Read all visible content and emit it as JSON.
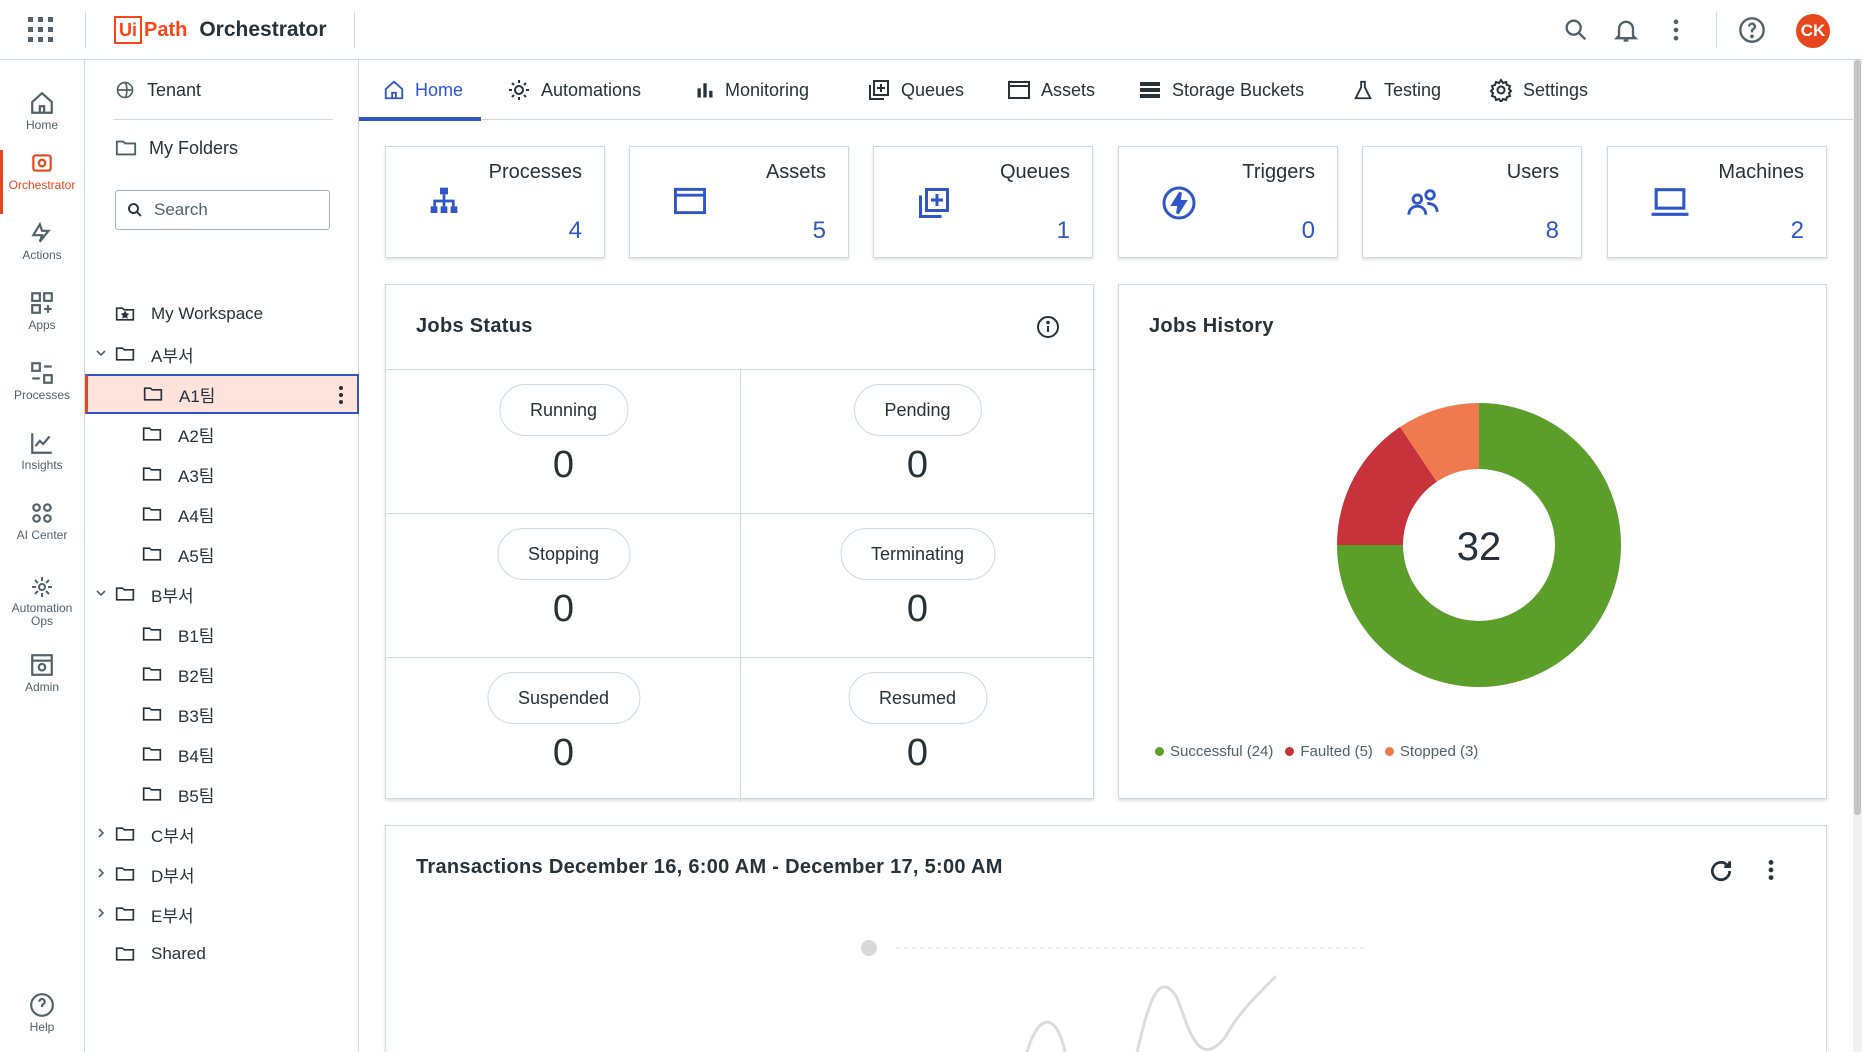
{
  "header": {
    "brand_ui": "Ui",
    "brand_path": "Path",
    "product": "Orchestrator",
    "avatar_initials": "CK"
  },
  "rail": {
    "items": [
      {
        "label": "Home",
        "icon": "home-icon"
      },
      {
        "label": "Orchestrator",
        "icon": "orchestrator-icon",
        "active": true
      },
      {
        "label": "Actions",
        "icon": "actions-icon"
      },
      {
        "label": "Apps",
        "icon": "apps-icon"
      },
      {
        "label": "Processes",
        "icon": "processes-icon"
      },
      {
        "label": "Insights",
        "icon": "insights-icon"
      },
      {
        "label": "AI Center",
        "icon": "ai-center-icon"
      },
      {
        "label": "Automation",
        "label2": "Ops",
        "icon": "automation-ops-icon"
      },
      {
        "label": "Admin",
        "icon": "admin-icon"
      },
      {
        "label": "Help",
        "icon": "help-icon"
      }
    ]
  },
  "tree": {
    "tenant": "Tenant",
    "my_folders": "My Folders",
    "search_placeholder": "Search",
    "nodes": [
      "My Workspace",
      "A부서",
      "A1팀",
      "A2팀",
      "A3팀",
      "A4팀",
      "A5팀",
      "B부서",
      "B1팀",
      "B2팀",
      "B3팀",
      "B4팀",
      "B5팀",
      "C부서",
      "D부서",
      "E부서",
      "Shared"
    ],
    "selected": "A1팀"
  },
  "tabs": [
    "Home",
    "Automations",
    "Monitoring",
    "Queues",
    "Assets",
    "Storage Buckets",
    "Testing",
    "Settings"
  ],
  "stats": [
    {
      "title": "Processes",
      "value": "4",
      "icon": "processes-tree-icon"
    },
    {
      "title": "Assets",
      "value": "5",
      "icon": "assets-window-icon"
    },
    {
      "title": "Queues",
      "value": "1",
      "icon": "queues-add-icon"
    },
    {
      "title": "Triggers",
      "value": "0",
      "icon": "triggers-bolt-icon"
    },
    {
      "title": "Users",
      "value": "8",
      "icon": "users-icon"
    },
    {
      "title": "Machines",
      "value": "2",
      "icon": "machines-laptop-icon"
    }
  ],
  "jobs_status": {
    "title": "Jobs Status",
    "cells": [
      {
        "label": "Running",
        "value": "0"
      },
      {
        "label": "Pending",
        "value": "0"
      },
      {
        "label": "Stopping",
        "value": "0"
      },
      {
        "label": "Terminating",
        "value": "0"
      },
      {
        "label": "Suspended",
        "value": "0"
      },
      {
        "label": "Resumed",
        "value": "0"
      }
    ]
  },
  "jobs_history": {
    "title": "Jobs History",
    "total": "32",
    "legend": [
      "Successful (24)",
      "Faulted (5)",
      "Stopped (3)"
    ]
  },
  "chart_data": {
    "type": "pie",
    "title": "Jobs History",
    "categories": [
      "Successful",
      "Faulted",
      "Stopped"
    ],
    "values": [
      24,
      5,
      3
    ],
    "colors": [
      "#5c9e2a",
      "#c8323b",
      "#f07a50"
    ],
    "center_label": "32"
  },
  "transactions": {
    "title": "Transactions December 16, 6:00 AM - December 17, 5:00 AM"
  }
}
